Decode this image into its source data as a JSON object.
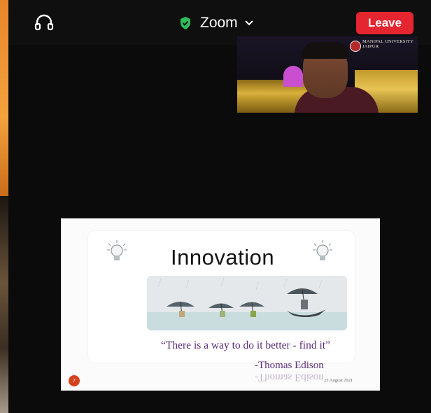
{
  "topbar": {
    "app_name": "Zoom",
    "leave_label": "Leave",
    "icons": {
      "audio": "headset-icon",
      "security": "shield-check-icon",
      "menu": "chevron-down-icon"
    },
    "colors": {
      "leave": "#e5252f",
      "shield": "#2fbd59"
    }
  },
  "video": {
    "overlay_org": "MANIPAL UNIVERSITY JAIPUR"
  },
  "slide": {
    "title": "Innovation",
    "quote": "“There is a way to do it better - find it”",
    "author": "-Thomas Edison",
    "page_number": "7",
    "date": "23 August 2021",
    "accent": "#5b2e7a"
  }
}
